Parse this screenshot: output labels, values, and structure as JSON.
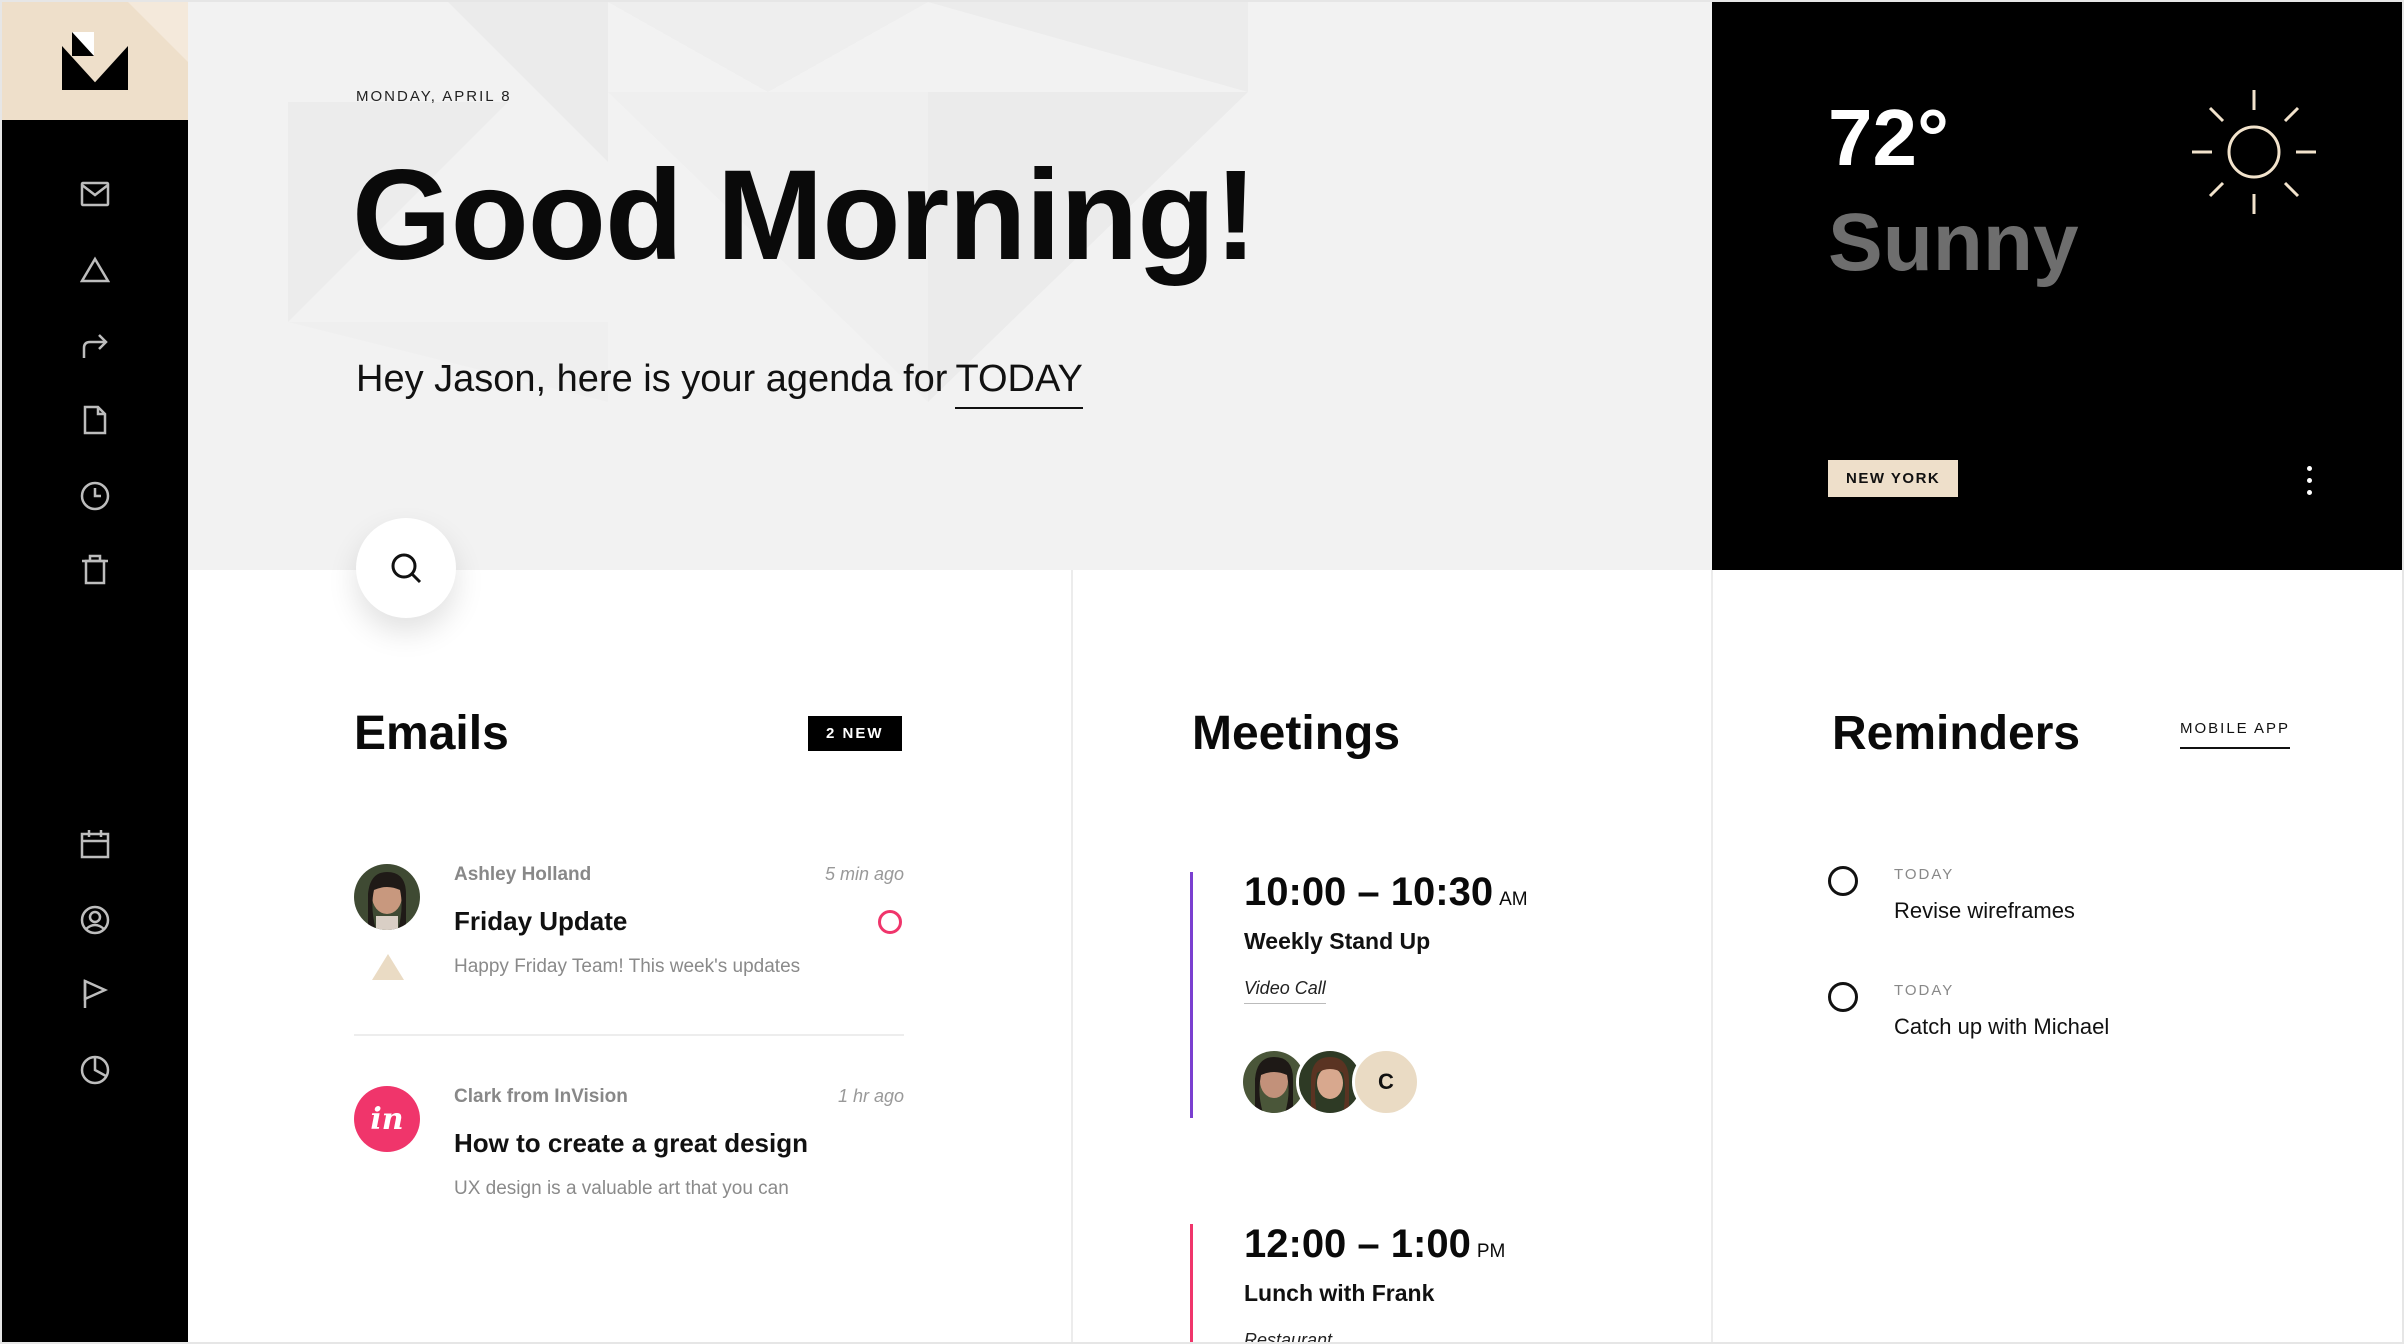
{
  "sidebar": {
    "logo_icon": "brand-logo-icon",
    "top_icons": [
      "mail-icon",
      "alert-triangle-icon",
      "share-arrow-icon",
      "document-icon",
      "clock-icon",
      "trash-icon"
    ],
    "bottom_icons": [
      "calendar-icon",
      "user-profile-icon",
      "flag-icon",
      "pie-chart-icon"
    ]
  },
  "header": {
    "date": "MONDAY, APRIL 8",
    "greeting": "Good Morning!",
    "agenda_prefix": "Hey Jason, here is your agenda for",
    "agenda_highlight": "TODAY"
  },
  "weather": {
    "temperature": "72°",
    "condition": "Sunny",
    "location": "NEW YORK",
    "icon": "sun-icon"
  },
  "emails": {
    "title": "Emails",
    "badge": "2 NEW",
    "items": [
      {
        "sender": "Ashley Holland",
        "time": "5 min ago",
        "subject": "Friday Update",
        "preview": "Happy Friday Team! This week's updates",
        "unread": true
      },
      {
        "sender": "Clark from InVision",
        "time": "1 hr ago",
        "subject": "How to create a great design",
        "preview": "UX design is a valuable art that you can",
        "avatar_text": "in"
      }
    ]
  },
  "meetings": {
    "title": "Meetings",
    "items": [
      {
        "time": "10:00 – 10:30",
        "ampm": "AM",
        "title": "Weekly Stand Up",
        "location": "Video Call",
        "attendee_initial": "C",
        "accent": "#7a3fd0"
      },
      {
        "time": "12:00 – 1:00",
        "ampm": "PM",
        "title": "Lunch with Frank",
        "location": "Restaurant",
        "accent": "#f0356b"
      }
    ]
  },
  "reminders": {
    "title": "Reminders",
    "link": "MOBILE APP",
    "items": [
      {
        "label": "TODAY",
        "text": "Revise wireframes"
      },
      {
        "label": "TODAY",
        "text": "Catch up with Michael"
      }
    ]
  },
  "colors": {
    "beige": "#eedfca",
    "pink": "#f0356b",
    "purple": "#7a3fd0",
    "black": "#000000"
  }
}
